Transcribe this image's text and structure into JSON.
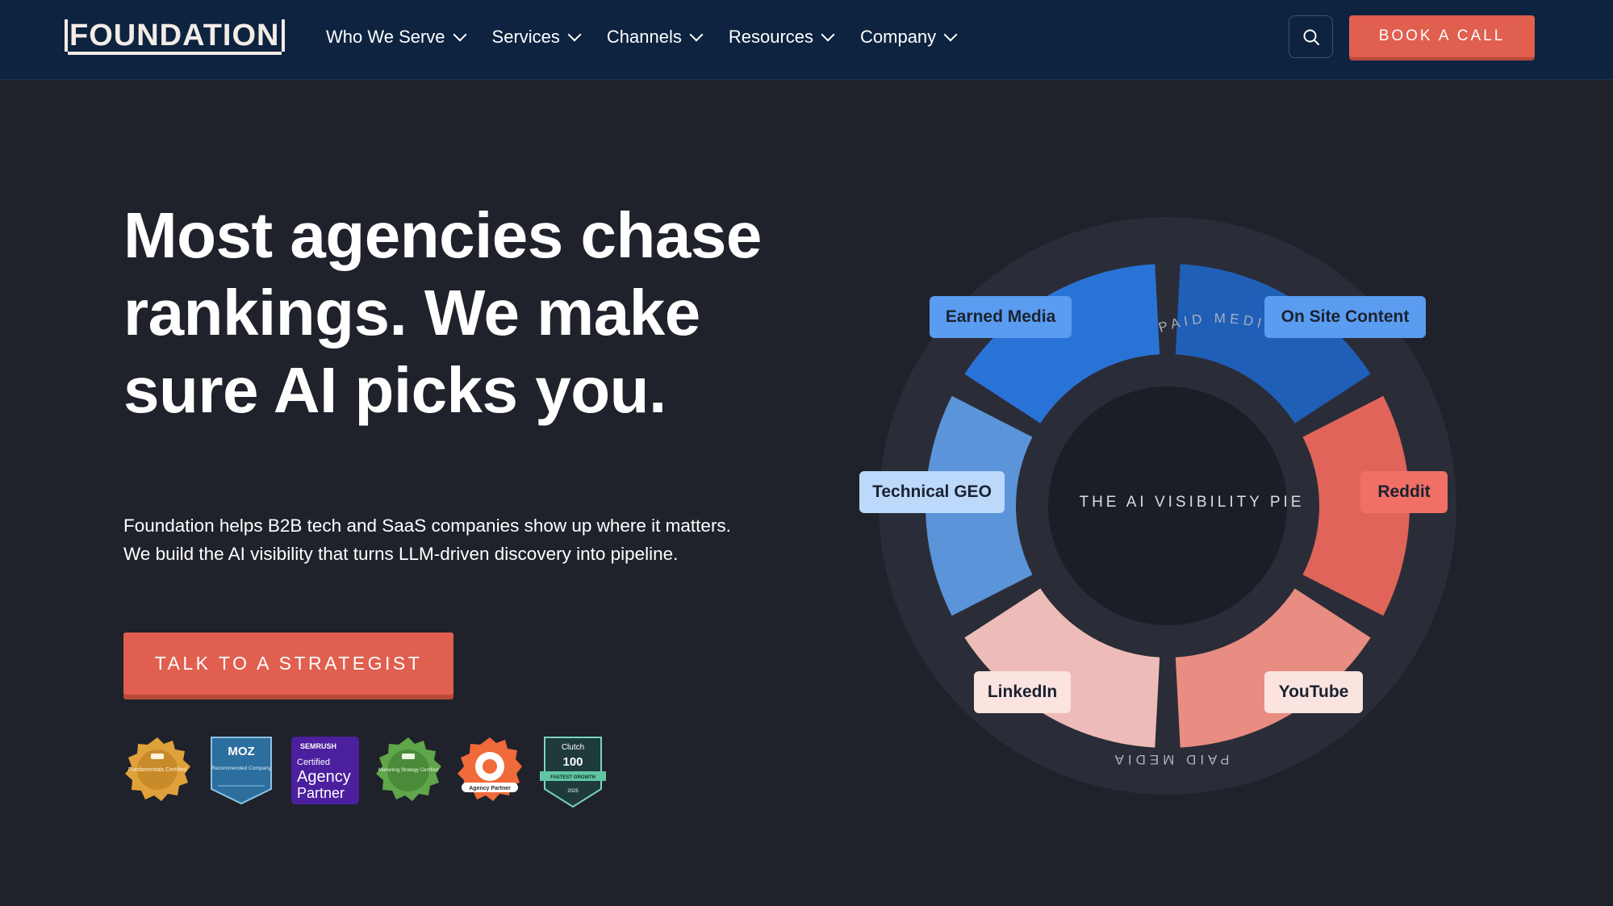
{
  "header": {
    "logo_text": "FOUNDATION",
    "nav": [
      {
        "label": "Who We Serve"
      },
      {
        "label": "Services"
      },
      {
        "label": "Channels"
      },
      {
        "label": "Resources"
      },
      {
        "label": "Company"
      }
    ],
    "search_icon": "search-icon",
    "cta_label": "BOOK A CALL"
  },
  "hero": {
    "headline_lines": [
      "Most agencies chase",
      "rankings. We make",
      "sure AI picks you."
    ],
    "sub_lines": [
      "Foundation helps B2B tech and SaaS companies show up where it matters.",
      "We build the AI visibility that turns LLM-driven discovery into pipeline."
    ],
    "cta_label": "TALK TO A STRATEGIST"
  },
  "badges": [
    {
      "name": "linkedin-fundamentals-badge",
      "text": "Fundamentals Certified"
    },
    {
      "name": "moz-badge",
      "title": "MOZ",
      "text": "Recommended Company"
    },
    {
      "name": "semrush-badge",
      "title": "SEMRUSH",
      "line1": "Certified",
      "line2": "Agency",
      "line3": "Partner"
    },
    {
      "name": "linkedin-marketing-strategy-badge",
      "text": "Marketing Strategy Certified"
    },
    {
      "name": "hubspot-agency-partner-badge",
      "text": "Agency Partner"
    },
    {
      "name": "clutch-badge",
      "title": "Clutch",
      "number": "100",
      "text": "FASTEST GROWTH",
      "year": "2025"
    }
  ],
  "pie": {
    "center_label": "THE AI VISIBILITY PIE",
    "outer_label": "PAID MEDIA",
    "segments": [
      {
        "label": "Earned Media",
        "color": "#2a73d6",
        "pill": "#5a9cf0"
      },
      {
        "label": "On Site Content",
        "color": "#1f5fb8",
        "pill": "#5a9cf0"
      },
      {
        "label": "Reddit",
        "color": "#e0645a",
        "pill": "#f07066"
      },
      {
        "label": "YouTube",
        "color": "#e98c82",
        "pill": "#fbe3df"
      },
      {
        "label": "LinkedIn",
        "color": "#eebcb8",
        "pill": "#fbe3df"
      },
      {
        "label": "Technical GEO",
        "color": "#5b94d8",
        "pill": "#bcd9fb"
      }
    ]
  },
  "colors": {
    "nav_bg": "#0d2340",
    "page_bg": "#1f222b",
    "accent": "#e05f4f"
  }
}
